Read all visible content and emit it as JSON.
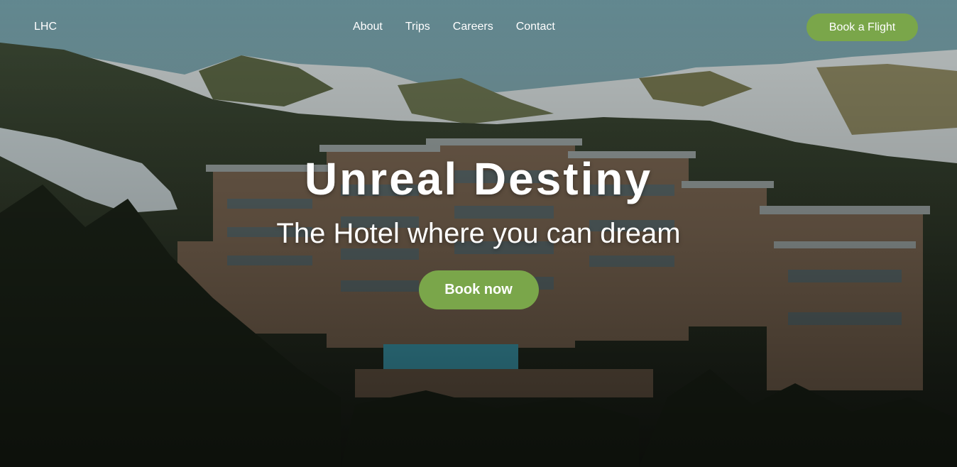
{
  "navbar": {
    "logo": "LHC",
    "links": [
      {
        "label": "About"
      },
      {
        "label": "Trips"
      },
      {
        "label": "Careers"
      },
      {
        "label": "Contact"
      }
    ],
    "cta_label": "Book a Flight"
  },
  "hero": {
    "title": "Unreal Destiny",
    "subtitle": "The Hotel where you can dream",
    "button_label": "Book now",
    "background": "aerial-mountain-hotel-photo"
  },
  "colors": {
    "accent": "#7aa64a",
    "text": "#ffffff"
  }
}
